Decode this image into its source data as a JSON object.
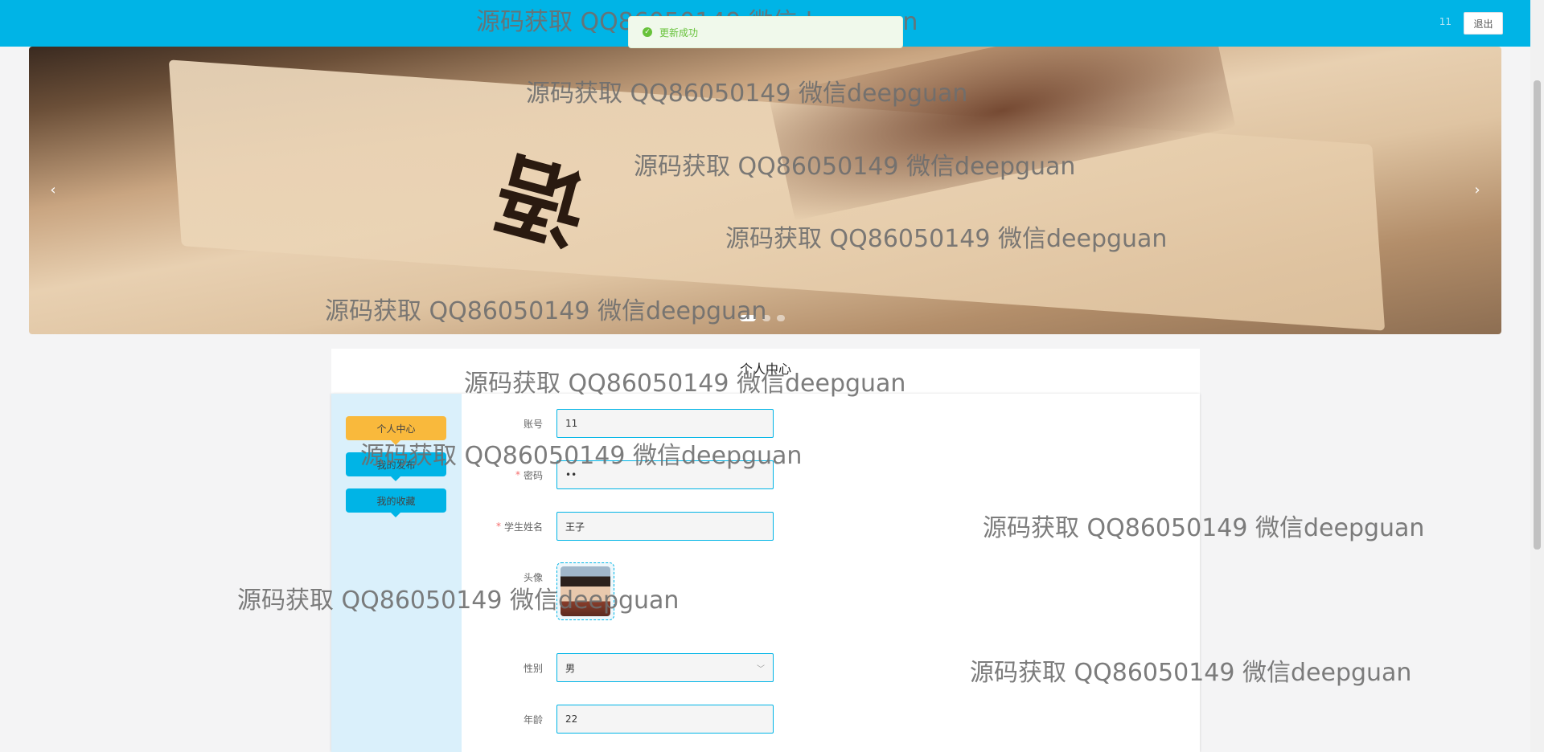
{
  "header": {
    "user_name": "11",
    "logout_label": "退出"
  },
  "toast": {
    "message": "更新成功"
  },
  "carousel": {
    "prev_icon": "‹",
    "next_icon": "›",
    "slide_count": 3,
    "active_slide": 1
  },
  "page_title": "个人中心",
  "sidebar": {
    "items": [
      {
        "label": "个人中心",
        "active": true
      },
      {
        "label": "我的发布",
        "active": false
      },
      {
        "label": "我的收藏",
        "active": false
      }
    ]
  },
  "form": {
    "account": {
      "label": "账号",
      "value": "11",
      "required": false
    },
    "password": {
      "label": "密码",
      "value": "••",
      "required": true
    },
    "student_name": {
      "label": "学生姓名",
      "value": "王子",
      "required": true
    },
    "avatar": {
      "label": "头像"
    },
    "gender": {
      "label": "性别",
      "value": "男"
    },
    "age": {
      "label": "年龄",
      "value": "22"
    }
  },
  "watermark": "源码获取 QQ86050149 微信deepguan",
  "colors": {
    "topbar": "#00b4e6",
    "sidebar_active": "#f9b93c",
    "sidebar_item": "#00b4e6",
    "sidebar_bg": "#daf0fb",
    "success": "#67c23a"
  }
}
